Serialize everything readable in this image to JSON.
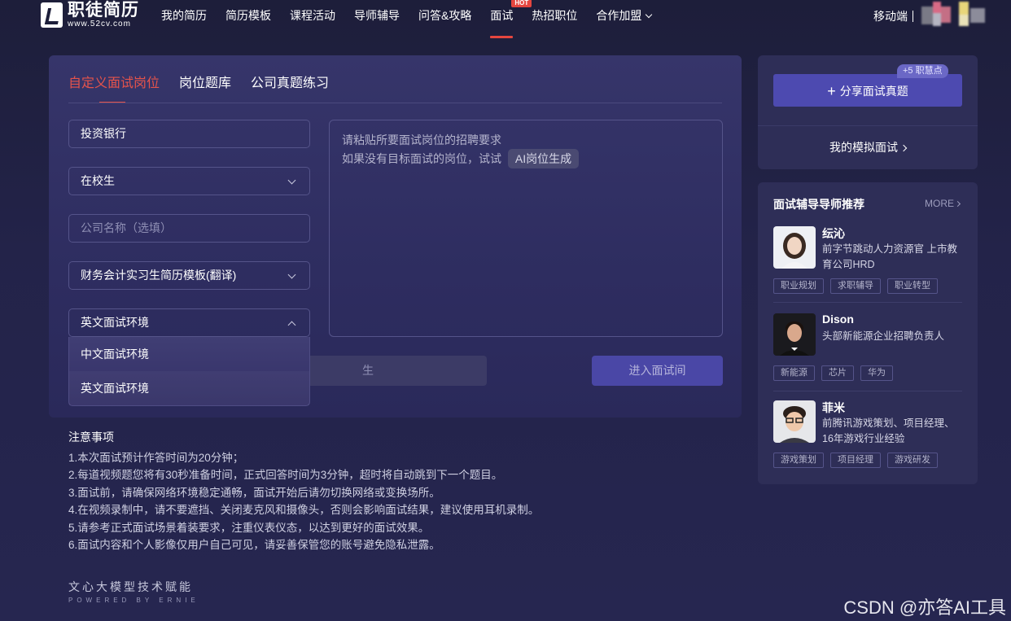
{
  "header": {
    "logo_cn": "职徒简历",
    "logo_url": "www.52cv.com",
    "nav": [
      {
        "label": "我的简历"
      },
      {
        "label": "简历模板"
      },
      {
        "label": "课程活动"
      },
      {
        "label": "导师辅导"
      },
      {
        "label": "问答&攻略"
      },
      {
        "label": "面试",
        "badge": "HOT",
        "active": true
      },
      {
        "label": "热招职位"
      },
      {
        "label": "合作加盟",
        "dropdown": true
      }
    ],
    "mobile_label": "移动端"
  },
  "tabs": [
    {
      "label": "自定义面试岗位",
      "active": true
    },
    {
      "label": "岗位题库"
    },
    {
      "label": "公司真题练习"
    }
  ],
  "form": {
    "position_value": "投资银行",
    "identity_value": "在校生",
    "company_placeholder": "公司名称（选填）",
    "template_value": "财务会计实习生简历模板(翻译)",
    "environment_value": "英文面试环境",
    "environment_options": [
      "中文面试环境",
      "英文面试环境"
    ],
    "jd_hint_line1": "请粘贴所要面试岗位的招聘要求",
    "jd_hint_line2": "如果没有目标面试的岗位，试试",
    "ai_button": "AI岗位生成",
    "name_input_tail": "生",
    "enter_button": "进入面试间"
  },
  "notes": {
    "title": "注意事项",
    "items": [
      "1.本次面试预计作答时间为20分钟；",
      "2.每道视频题您将有30秒准备时间，正式回答时间为3分钟，超时将自动跳到下一个题目。",
      "3.面试前，请确保网络环境稳定通畅，面试开始后请勿切换网络或变换场所。",
      "4.在视频录制中，请不要遮挡、关闭麦克风和摄像头，否则会影响面试结果，建议使用耳机录制。",
      "5.请参考正式面试场景着装要求，注重仪表仪态，以达到更好的面试效果。",
      "6.面试内容和个人影像仅用户自己可见，请妥善保管您的账号避免隐私泄露。"
    ]
  },
  "powered": {
    "cn": "文心大模型技术赋能",
    "en": "POWERED BY ERNIE"
  },
  "share": {
    "button": "分享面试真题",
    "points_badge": "+5 职慧点",
    "mock_link": "我的模拟面试"
  },
  "mentors": {
    "title": "面试辅导导师推荐",
    "more": "MORE",
    "list": [
      {
        "name": "纭沁",
        "desc": "前字节跳动人力资源官 上市教育公司HRD",
        "tags": [
          "职业规划",
          "求职辅导",
          "职业转型"
        ]
      },
      {
        "name": "Dison",
        "desc": "头部新能源企业招聘负责人",
        "tags": [
          "新能源",
          "芯片",
          "华为"
        ]
      },
      {
        "name": "菲米",
        "desc": "前腾讯游戏策划、项目经理、16年游戏行业经验",
        "tags": [
          "游戏策划",
          "项目经理",
          "游戏研发"
        ]
      }
    ]
  },
  "watermark": "CSDN @亦答AI工具",
  "colors": {
    "accent_red": "#e5463f",
    "button_purple": "#4d4ab0",
    "background": "#1d1e3a"
  }
}
